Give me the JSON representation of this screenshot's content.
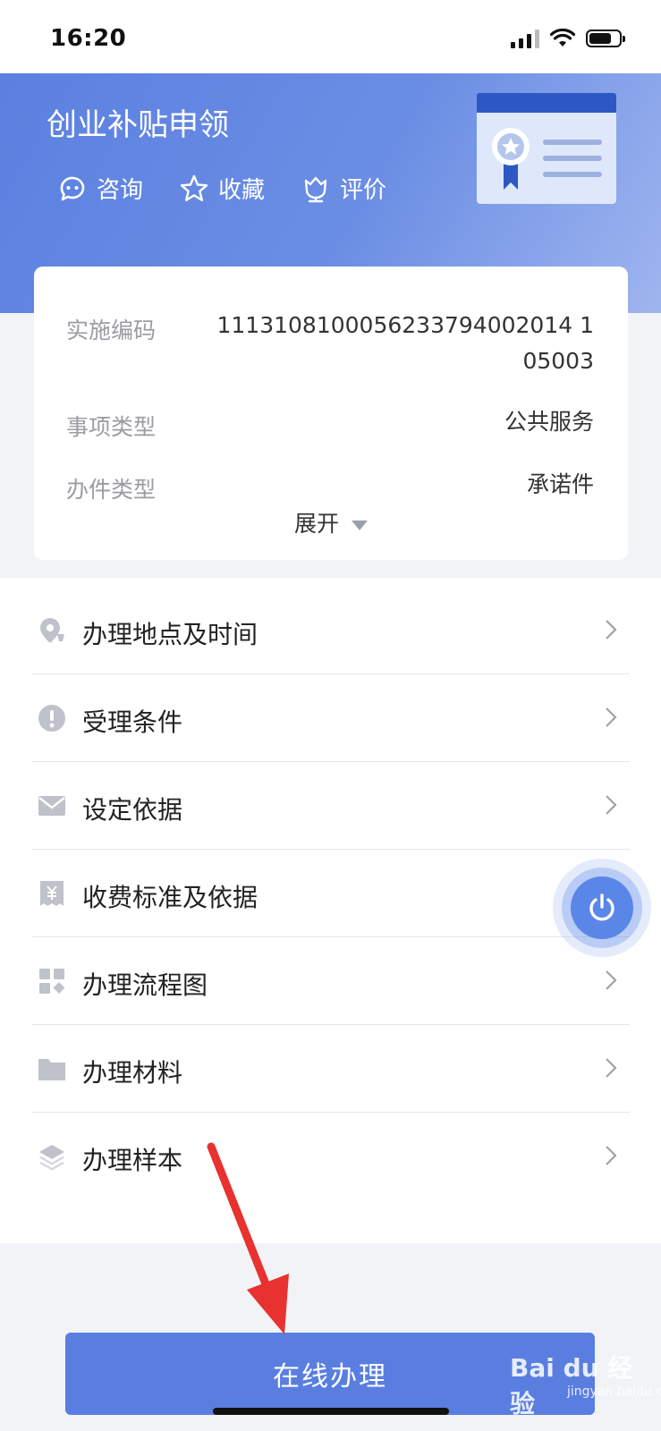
{
  "status_bar": {
    "time": "16:20"
  },
  "header": {
    "title": "创业补贴申领",
    "actions": [
      {
        "label": "咨询",
        "icon": "chat-bubble-icon"
      },
      {
        "label": "收藏",
        "icon": "star-icon"
      },
      {
        "label": "评价",
        "icon": "flower-rating-icon"
      }
    ]
  },
  "info": {
    "rows": [
      {
        "label": "实施编码",
        "value_line1": "1113108100056233794002014 1",
        "value_line2": "05003"
      },
      {
        "label": "事项类型",
        "value": "公共服务"
      },
      {
        "label": "办件类型",
        "value": "承诺件"
      }
    ],
    "expand_label": "展开"
  },
  "menu": [
    {
      "label": "办理地点及时间",
      "icon": "location-pin-icon"
    },
    {
      "label": "受理条件",
      "icon": "exclamation-circle-icon"
    },
    {
      "label": "设定依据",
      "icon": "envelope-icon"
    },
    {
      "label": "收费标准及依据",
      "icon": "yen-receipt-icon"
    },
    {
      "label": "办理流程图",
      "icon": "grid-flow-icon"
    },
    {
      "label": "办理材料",
      "icon": "folder-icon"
    },
    {
      "label": "办理样本",
      "icon": "layers-icon"
    }
  ],
  "primary_button": {
    "label": "在线办理"
  },
  "watermark": {
    "brand": "Bai du 经验",
    "site": "jingyan.baidu.com"
  },
  "colors": {
    "primary": "#5a7ee0",
    "header_start": "#5b80e0",
    "header_end": "#9fb5ef",
    "annotation": "#e8322f"
  }
}
